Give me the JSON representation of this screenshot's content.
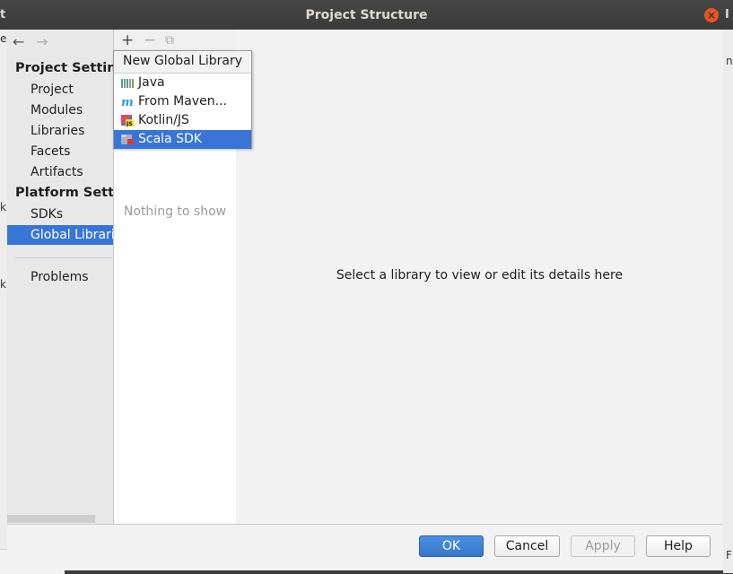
{
  "window": {
    "title": "Project Structure",
    "close_glyph": "×"
  },
  "background": {
    "left_fragments": [
      "t",
      "e",
      "k",
      "k"
    ],
    "right_fragments": [
      "I",
      "n.",
      "F"
    ],
    "bottom_fragments": [
      "≡",
      "×"
    ]
  },
  "sidebar": {
    "back_icon": "←",
    "forward_icon": "→",
    "sections": [
      {
        "title": "Project Settings",
        "items": [
          "Project",
          "Modules",
          "Libraries",
          "Facets",
          "Artifacts"
        ]
      },
      {
        "title": "Platform Settings",
        "items": [
          "SDKs",
          "Global Libraries"
        ]
      }
    ],
    "selected_item": "Global Libraries",
    "problems_label": "Problems"
  },
  "middle": {
    "toolbar": {
      "add_glyph": "+",
      "remove_glyph": "−",
      "copy_glyph": "⧉"
    },
    "empty_text": "Nothing to show"
  },
  "popup": {
    "title": "New Global Library",
    "items": [
      {
        "label": "Java",
        "icon": "java-library-icon"
      },
      {
        "label": "From Maven...",
        "icon": "maven-icon"
      },
      {
        "label": "Kotlin/JS",
        "icon": "kotlin-js-icon"
      },
      {
        "label": "Scala SDK",
        "icon": "scala-sdk-icon"
      }
    ],
    "selected_index": 3
  },
  "details": {
    "hint": "Select a library to view or edit its details here"
  },
  "footer": {
    "ok": "OK",
    "cancel": "Cancel",
    "apply": "Apply",
    "help": "Help"
  },
  "colors": {
    "selection": "#3875d7",
    "primary_button": "#3777c9",
    "close_button": "#e95420"
  }
}
